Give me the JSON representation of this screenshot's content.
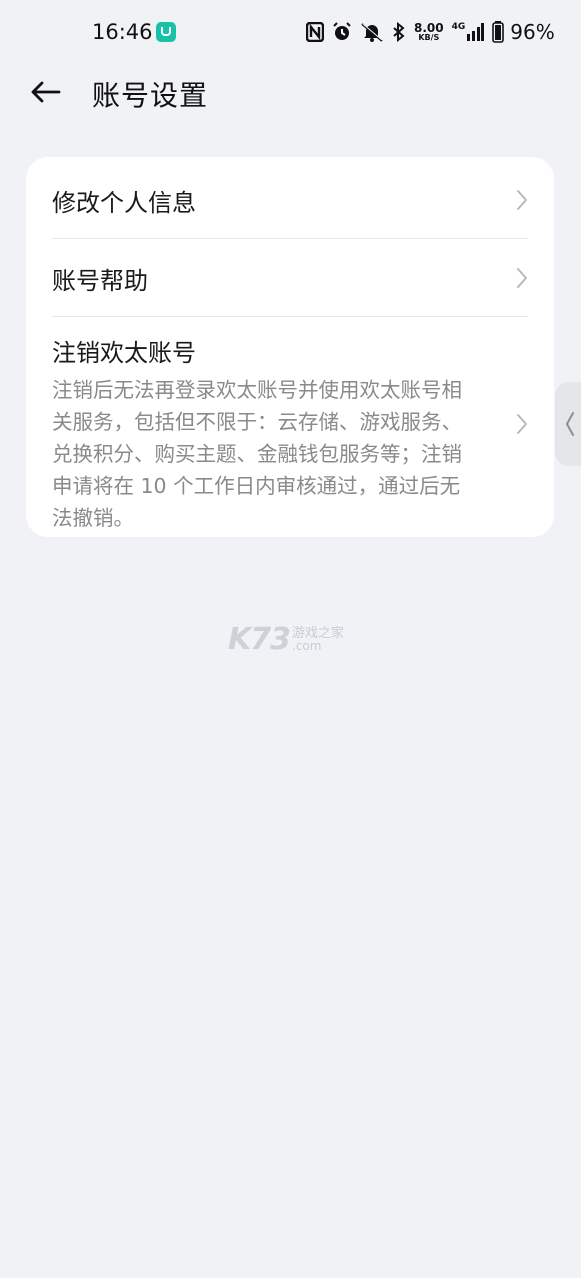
{
  "status_bar": {
    "time": "16:46",
    "net_speed_value": "8.00",
    "net_speed_unit": "KB/S",
    "network_type": "4G",
    "battery_percent": "96%"
  },
  "header": {
    "title": "账号设置"
  },
  "settings": {
    "items": [
      {
        "label": "修改个人信息"
      },
      {
        "label": "账号帮助"
      },
      {
        "label": "注销欢太账号",
        "description": "注销后无法再登录欢太账号并使用欢太账号相关服务，包括但不限于：云存储、游戏服务、兑换积分、购买主题、金融钱包服务等；注销申请将在 10 个工作日内审核通过，通过后无法撤销。"
      }
    ]
  },
  "watermark": {
    "main": "K73",
    "side_top": "游戏之家",
    "side_bottom": ".com"
  },
  "icons": {
    "back": "arrow-left-icon",
    "chevron": "chevron-right-icon",
    "side_handle": "chevron-left-icon"
  }
}
